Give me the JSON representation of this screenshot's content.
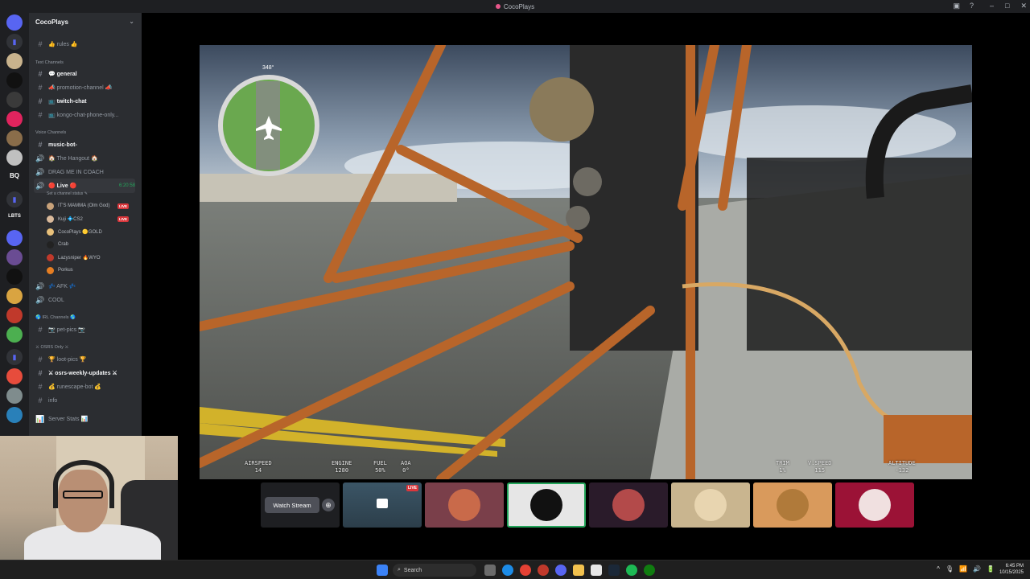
{
  "window": {
    "title": "CocoPlays",
    "controls": [
      "–",
      "□",
      "✕"
    ],
    "tools": [
      "▣",
      "?"
    ]
  },
  "server": {
    "name": "CocoPlays"
  },
  "guilds": [
    {
      "color": "#5865f2"
    },
    {
      "color": "#2b2d31"
    },
    {
      "color": "#c9b38d"
    },
    {
      "color": "#111111"
    },
    {
      "color": "#3a3a3a"
    },
    {
      "color": "#e0245e"
    },
    {
      "color": "#8a6d4a"
    },
    {
      "color": "#c0c0c0"
    },
    {
      "label": "BQ"
    },
    {
      "color": "#2b2d31"
    },
    {
      "label": "LBTS"
    },
    {
      "color": "#5865f2"
    },
    {
      "color": "#6a4c93"
    },
    {
      "color": "#111111"
    },
    {
      "color": "#d9a441"
    },
    {
      "color": "#c0392b"
    },
    {
      "color": "#4caf50"
    },
    {
      "color": "#2b2d31"
    },
    {
      "color": "#e74c3c"
    },
    {
      "color": "#7f8c8d"
    },
    {
      "color": "#2980b9"
    }
  ],
  "channels": [
    {
      "icon": "#",
      "label": "👍 rules 👍",
      "type": "text"
    },
    {
      "category": "Text Channels"
    },
    {
      "icon": "#",
      "label": "💬 general",
      "type": "text",
      "bold": true
    },
    {
      "icon": "#",
      "label": "📣 promotion-channel 📣",
      "type": "text"
    },
    {
      "icon": "#",
      "label": "📺 twitch-chat",
      "type": "text",
      "bold": true
    },
    {
      "icon": "#",
      "label": "📺 kongo-chat-phone-only...",
      "type": "text"
    },
    {
      "category": "Voice Channels"
    },
    {
      "icon": "#",
      "label": "music-bot-",
      "type": "text",
      "bold": true
    },
    {
      "icon": "🔊",
      "label": "🏠 The Hangout 🏠",
      "type": "voice"
    },
    {
      "icon": "🔊",
      "label": "DRAG ME IN COACH",
      "type": "voice"
    }
  ],
  "live_channel": {
    "label": "🔴 Live 🔴",
    "timer": "6:20:58",
    "status": "Set a channel status ✎",
    "users": [
      {
        "name": "IT'S MAMMA (Olm God)",
        "live": "LIVE",
        "color": "#c8a27a"
      },
      {
        "name": "Kuji 💠CS2",
        "live": "LIVE",
        "color": "#d9b99b"
      },
      {
        "name": "CocoPlays 🟡GOLD",
        "live": "",
        "color": "#e8c07a"
      },
      {
        "name": "Crab",
        "live": "",
        "color": "#222222"
      },
      {
        "name": "Lazysniper 🔥WYO",
        "live": "",
        "color": "#c0392b"
      },
      {
        "name": "Porkus",
        "live": "",
        "color": "#e67e22"
      }
    ]
  },
  "more_channels": [
    {
      "icon": "🔊",
      "label": "💤 AFK 💤",
      "type": "voice"
    },
    {
      "icon": "🔊",
      "label": "COOL",
      "type": "voice"
    },
    {
      "category": "🌎 IRL Channels 🌎"
    },
    {
      "icon": "#",
      "label": "📷 pet-pics 📷",
      "type": "text"
    },
    {
      "category": "⚔ OSRS Only ⚔"
    },
    {
      "icon": "#",
      "label": "🏆 loot-pics 🏆",
      "type": "text"
    },
    {
      "icon": "#",
      "label": "⚔ osrs-weekly-updates ⚔",
      "type": "text",
      "bold": true
    },
    {
      "icon": "#",
      "label": "💰 runescape-bot 💰",
      "type": "text"
    },
    {
      "icon": "#",
      "label": "info",
      "type": "text"
    },
    {
      "icon": "📊",
      "label": "Server Stats 📊",
      "type": "category"
    }
  ],
  "hud": {
    "heading": "348°",
    "airspeed": {
      "label": "AIRSPEED",
      "value": "14"
    },
    "engine": {
      "label": "ENGINE",
      "value": "1280"
    },
    "fuel": {
      "label": "FUEL",
      "value": "50%"
    },
    "aoa": {
      "label": "AOA",
      "value": "0°"
    },
    "trim": {
      "label": "TRIM",
      "value": "1%"
    },
    "vspeed": {
      "label": "V.SPEED",
      "value": "115"
    },
    "altitude": {
      "label": "ALTITUDE",
      "value": "-132"
    }
  },
  "stream_tiles": {
    "watch_label": "Watch Stream",
    "live_badge": "LIVE",
    "tiles": [
      {
        "bg": "#7a3f4a",
        "face": "#c96a4a"
      },
      {
        "bg": "#e6e6e6",
        "face": "#111111"
      },
      {
        "bg": "#2a1b2a",
        "face": "#b34a4a"
      },
      {
        "bg": "#c9b58f",
        "face": "#e8d5b0"
      },
      {
        "bg": "#d99a5c",
        "face": "#b07a3a"
      },
      {
        "bg": "#9b1236",
        "face": "#f0e0e0"
      }
    ]
  },
  "taskbar": {
    "search_label": "Search",
    "time": "6:45 PM",
    "date": "10/15/2025",
    "tray": [
      "^",
      "🎙",
      "📶",
      "🔊",
      "🔋"
    ]
  }
}
